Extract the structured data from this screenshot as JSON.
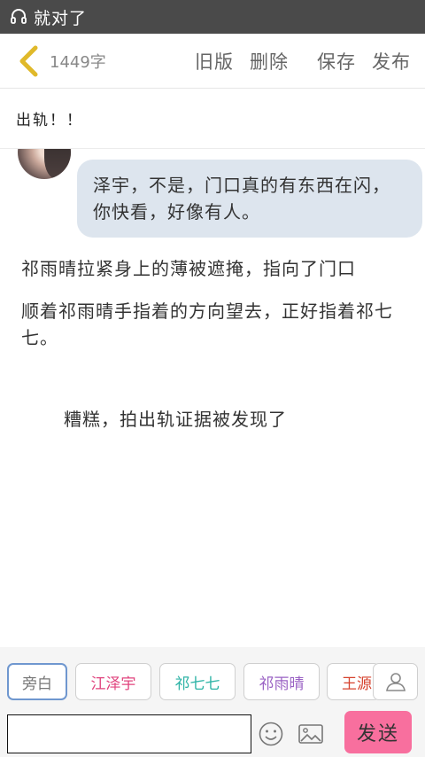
{
  "statusbar": {
    "app_name": "就对了"
  },
  "topbar": {
    "word_count": "1449字",
    "actions": [
      "旧版",
      "删除",
      "保存",
      "发布"
    ]
  },
  "title": "出轨！！",
  "messages": [
    {
      "speaker": "江泽宇",
      "text": "泽宇，不是，门口真的有东西在闪，你快看，好像有人。"
    }
  ],
  "narration": [
    "祁雨晴拉紧身上的薄被遮掩，指向了门口",
    "顺着祁雨晴手指着的方向望去，正好指着祁七七。",
    "糟糕，拍出轨证据被发现了"
  ],
  "characters": [
    {
      "label": "旁白",
      "color": "#777777",
      "selected": true
    },
    {
      "label": "江泽宇",
      "color": "#e0447e"
    },
    {
      "label": "祁七七",
      "color": "#2eb3a6"
    },
    {
      "label": "祁雨晴",
      "color": "#9a62c4"
    },
    {
      "label": "王源",
      "color": "#d6432f"
    }
  ],
  "composer": {
    "input_value": "",
    "input_placeholder": "",
    "send_label": "发送"
  },
  "colors": {
    "accent": "#f86f9e",
    "bubble": "#dde5ee",
    "back_arrow": "#e0b92a"
  }
}
